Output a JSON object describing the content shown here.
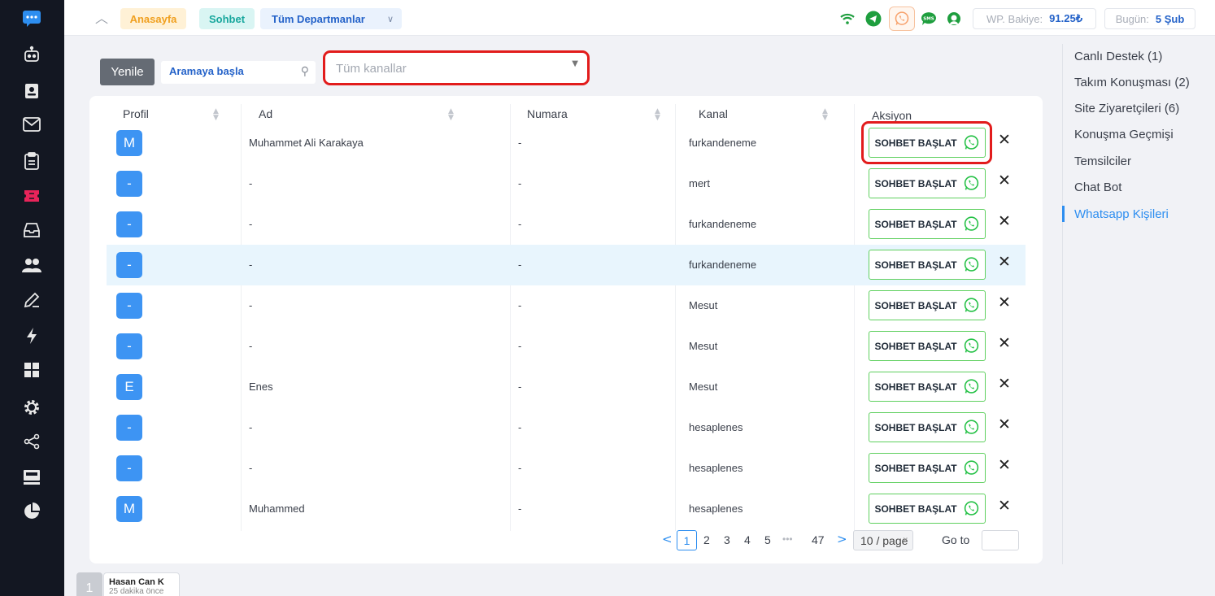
{
  "sidebar": {
    "icons": [
      "chat-bubble-icon",
      "robot-chat-icon",
      "contact-card-icon",
      "mail-icon",
      "clipboard-icon",
      "ticket-icon",
      "inbox-icon",
      "users-icon",
      "edit-icon",
      "bolt-icon",
      "grid-icon",
      "settings-icon",
      "share-icon",
      "monitor-icon",
      "pie-chart-icon"
    ],
    "accent": "#e8245a",
    "brand": "#2d8ef0"
  },
  "topbar": {
    "home_label": "Anasayfa",
    "chat_label": "Sohbet",
    "department_label": "Tüm Departmanlar",
    "wp_balance_label": "WP. Bakiye:",
    "wp_balance_value": "91.25₺",
    "today_label": "Bugün:",
    "today_value": "5 Şub",
    "sms_label": "SMS",
    "channel_icons": [
      "wifi-icon",
      "telegram-icon",
      "whatsapp-icon",
      "sms-icon",
      "support-icon"
    ]
  },
  "toolbar": {
    "refresh_label": "Yenile",
    "search_placeholder": "Aramaya başla",
    "channel_placeholder": "Tüm kanallar"
  },
  "table": {
    "columns": [
      "Profil",
      "Ad",
      "Numara",
      "Kanal",
      "Aksiyon"
    ],
    "action_label": "SOHBET BAŞLAT",
    "rows": [
      {
        "avatar": "M",
        "name": "Muhammet Ali Karakaya",
        "number": "-",
        "channel": "furkandeneme"
      },
      {
        "avatar": "-",
        "name": "-",
        "number": "-",
        "channel": "mert"
      },
      {
        "avatar": "-",
        "name": "-",
        "number": "-",
        "channel": "furkandeneme"
      },
      {
        "avatar": "-",
        "name": "-",
        "number": "-",
        "channel": "furkandeneme"
      },
      {
        "avatar": "-",
        "name": "-",
        "number": "-",
        "channel": "Mesut"
      },
      {
        "avatar": "-",
        "name": "-",
        "number": "-",
        "channel": "Mesut"
      },
      {
        "avatar": "E",
        "name": "Enes",
        "number": "-",
        "channel": "Mesut"
      },
      {
        "avatar": "-",
        "name": "-",
        "number": "-",
        "channel": "hesaplenes"
      },
      {
        "avatar": "-",
        "name": "-",
        "number": "-",
        "channel": "hesaplenes"
      },
      {
        "avatar": "M",
        "name": "Muhammed",
        "number": "-",
        "channel": "hesaplenes"
      }
    ]
  },
  "pagination": {
    "pages": [
      "1",
      "2",
      "3",
      "4",
      "5"
    ],
    "ellipsis": "•••",
    "last_page": "47",
    "page_size": "10 / page",
    "goto_label": "Go to"
  },
  "subnav": {
    "items": [
      "Canlı Destek (1)",
      "Takım Konuşması (2)",
      "Site Ziyaretçileri (6)",
      "Konuşma Geçmişi",
      "Temsilciler",
      "Chat Bot",
      "Whatsapp Kişileri"
    ],
    "active": "Whatsapp Kişileri"
  },
  "mini_chat": {
    "avatar": "1",
    "name": "Hasan Can K",
    "time": "25 dakika önce"
  }
}
